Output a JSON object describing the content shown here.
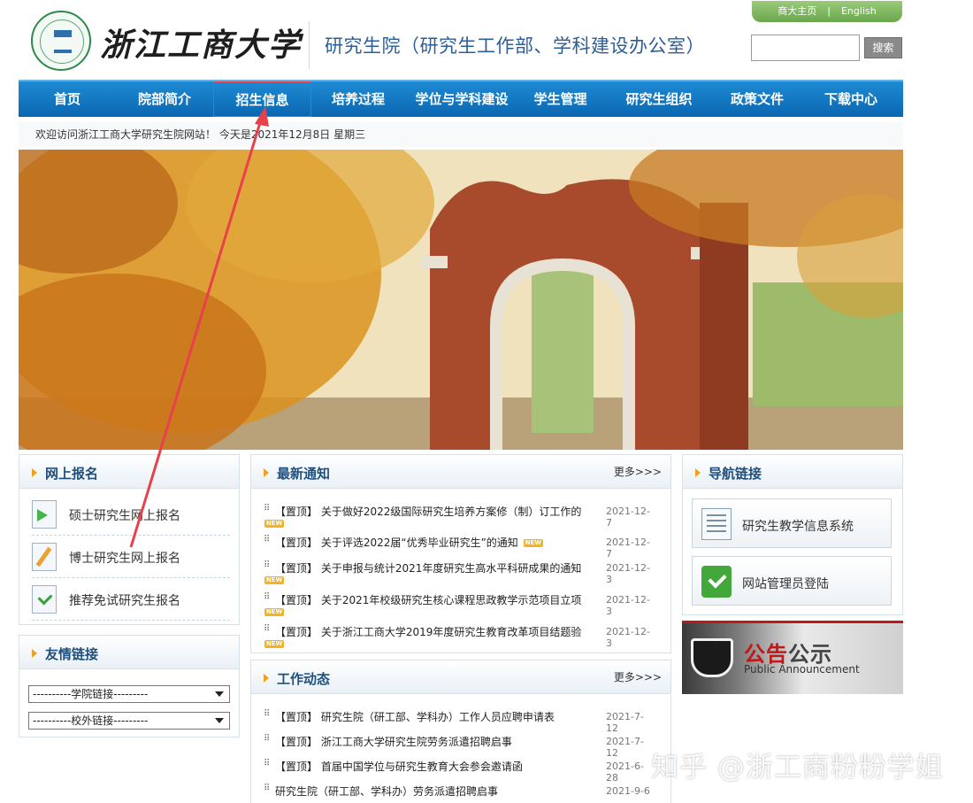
{
  "header": {
    "logo_text": "浙江工商大学",
    "dept_title": "研究生院（研究生工作部、学科建设办公室）",
    "top_links": [
      "商大主页",
      "|",
      "English"
    ],
    "search": {
      "placeholder": "",
      "button_label": "搜索"
    }
  },
  "nav": {
    "items": [
      "首页",
      "院部简介",
      "招生信息",
      "培养过程",
      "学位与学科建设",
      "学生管理",
      "研究生组织",
      "政策文件",
      "下载中心"
    ],
    "active": "招生信息"
  },
  "welcome_bar": "欢迎访问浙江工商大学研究生院网站！ 今天是2021年12月8日 星期三",
  "online_registration": {
    "title": "网上报名",
    "items": [
      {
        "label": "硕士研究生网上报名",
        "icon": "arrow-right-icon"
      },
      {
        "label": "博士研究生网上报名",
        "icon": "pencil-icon"
      },
      {
        "label": "推荐免试研究生报名",
        "icon": "checkmark-icon"
      }
    ]
  },
  "friend_links": {
    "title": "友情链接",
    "selects": [
      "----------学院链接---------",
      "----------校外链接---------"
    ]
  },
  "latest_notices": {
    "title": "最新通知",
    "more": "更多>>>",
    "new_badge": "NEW",
    "items": [
      {
        "title": "【置顶】 关于做好2022级国际研究生培养方案修（制）订工作的",
        "date": "2021-12-7"
      },
      {
        "title": "【置顶】 关于评选2022届“优秀毕业研究生”的通知",
        "date": "2021-12-7"
      },
      {
        "title": "【置顶】 关于申报与统计2021年度研究生高水平科研成果的通知",
        "date": "2021-12-3"
      },
      {
        "title": "【置顶】 关于2021年校级研究生核心课程思政教学示范项目立项",
        "date": "2021-12-3"
      },
      {
        "title": "【置顶】 关于浙江工商大学2019年度研究生教育改革项目结题验",
        "date": "2021-12-3"
      }
    ]
  },
  "work_news": {
    "title": "工作动态",
    "more": "更多>>>",
    "items": [
      {
        "title": "【置顶】 研究生院（研工部、学科办）工作人员应聘申请表",
        "date": "2021-7-12"
      },
      {
        "title": "【置顶】 浙江工商大学研究生院劳务派遣招聘启事",
        "date": "2021-7-12"
      },
      {
        "title": "【置顶】 首届中国学位与研究生教育大会参会邀请函",
        "date": "2021-6-28"
      },
      {
        "title": "研究生院（研工部、学科办）劳务派遣招聘启事",
        "date": "2021-9-6"
      }
    ]
  },
  "nav_links": {
    "title": "导航链接",
    "items": [
      {
        "label": "研究生教学信息系统",
        "icon": "document-icon"
      },
      {
        "label": "网站管理员登陆",
        "icon": "checkmark-icon"
      }
    ]
  },
  "announcement": {
    "title_red": "公告",
    "title_dark": "公示",
    "subtitle": "Public Announcement"
  },
  "watermark": "知乎 @浙工商粉粉学姐",
  "colors": {
    "nav_blue": "#0b66b1",
    "title_blue": "#1f4f7c",
    "annotation_red": "#e8414b",
    "badge_orange": "#f5b321"
  }
}
